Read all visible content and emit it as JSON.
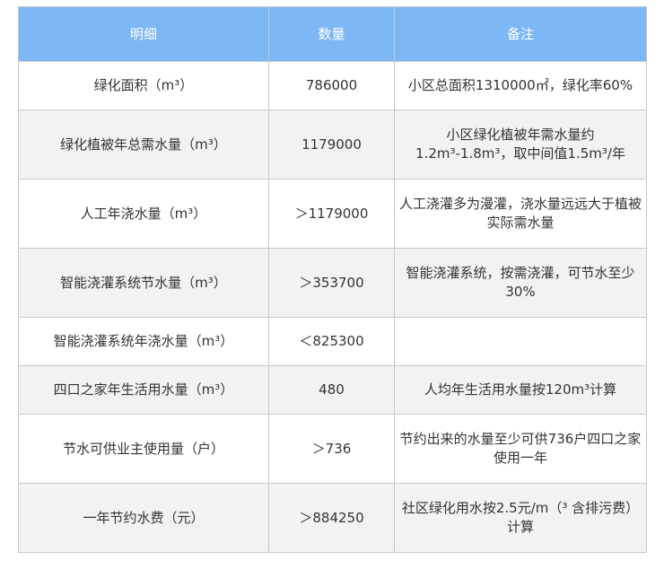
{
  "table": {
    "headers": [
      "明细",
      "数量",
      "备注"
    ],
    "rows": [
      {
        "item": "绿化面积（m³）",
        "quantity": "786000",
        "note": "小区总面积1310000㎡，绿化率60%"
      },
      {
        "item": "绿化植被年总需水量（m³）",
        "quantity": "1179000",
        "note": "小区绿化植被年需水量约1.2m³-1.8m³，取中间值1.5m³/年"
      },
      {
        "item": "人工年浇水量（m³）",
        "quantity": "＞1179000",
        "note": "人工浇灌多为漫灌，浇水量远远大于植被实际需水量"
      },
      {
        "item": "智能浇灌系统节水量（m³）",
        "quantity": "＞353700",
        "note": "智能浇灌系统，按需浇灌，可节水至少30%"
      },
      {
        "item": "智能浇灌系统年浇水量（m³）",
        "quantity": "＜825300",
        "note": ""
      },
      {
        "item": "四口之家年生活用水量（m³）",
        "quantity": "480",
        "note": "人均年生活用水量按120m³计算"
      },
      {
        "item": "节水可供业主使用量（户）",
        "quantity": "＞736",
        "note": "节约出来的水量至少可供736户四口之家使用一年"
      },
      {
        "item": "一年节约水费（元）",
        "quantity": "＞884250",
        "note": "社区绿化用水按2.5元/m（³ 含排污费）计算"
      }
    ]
  },
  "colors": {
    "header_bg": "#7db7f5",
    "header_text": "#ffffff",
    "row_alt_bg": "#f2f2f2",
    "border": "#c8c8c8"
  }
}
